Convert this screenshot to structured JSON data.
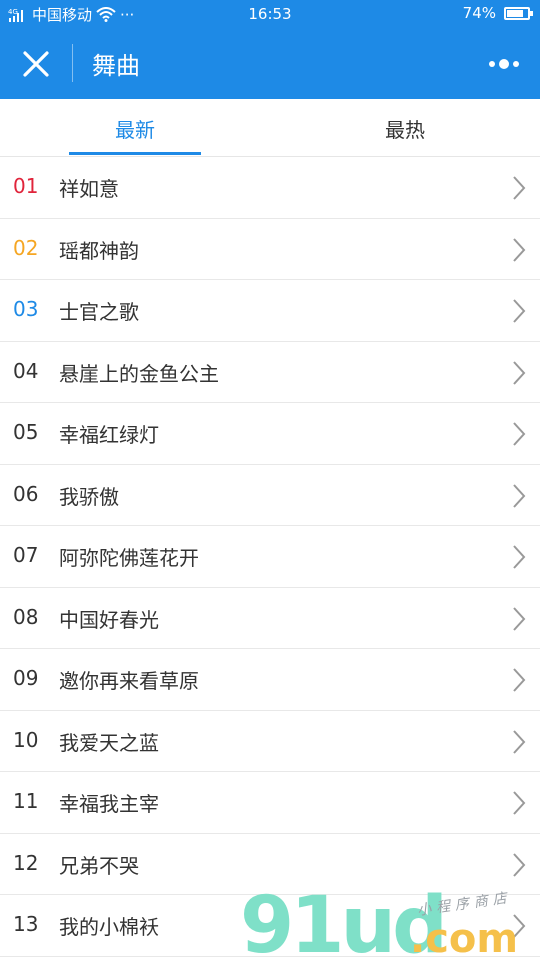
{
  "status_bar": {
    "carrier": "中国移动",
    "dots": "···",
    "time": "16:53",
    "battery_percent": "74%",
    "battery_level": 0.74
  },
  "nav": {
    "title": "舞曲"
  },
  "tabs": [
    {
      "label": "最新",
      "active": true
    },
    {
      "label": "最热",
      "active": false
    }
  ],
  "items": [
    {
      "num": "01",
      "title": "祥如意",
      "num_color": "#e0243b"
    },
    {
      "num": "02",
      "title": "瑶都神韵",
      "num_color": "#f5a623"
    },
    {
      "num": "03",
      "title": " 士官之歌",
      "num_color": "#1e8ae6"
    },
    {
      "num": "04",
      "title": "悬崖上的金鱼公主",
      "num_color": "#333333"
    },
    {
      "num": "05",
      "title": " 幸福红绿灯",
      "num_color": "#333333"
    },
    {
      "num": "06",
      "title": " 我骄傲",
      "num_color": "#333333"
    },
    {
      "num": "07",
      "title": "阿弥陀佛莲花开",
      "num_color": "#333333"
    },
    {
      "num": "08",
      "title": "中国好春光",
      "num_color": "#333333"
    },
    {
      "num": "09",
      "title": "邀你再来看草原",
      "num_color": "#333333"
    },
    {
      "num": "10",
      "title": " 我爱天之蓝",
      "num_color": "#333333"
    },
    {
      "num": "11",
      "title": "幸福我主宰",
      "num_color": "#333333"
    },
    {
      "num": "12",
      "title": " 兄弟不哭",
      "num_color": "#333333"
    },
    {
      "num": "13",
      "title": "我的小棉袄",
      "num_color": "#333333"
    }
  ],
  "watermark": {
    "logo": "91ud",
    "domain": ".com",
    "tagline": "小程序商店"
  },
  "colors": {
    "brand": "#1e8ae6",
    "text": "#333333"
  }
}
